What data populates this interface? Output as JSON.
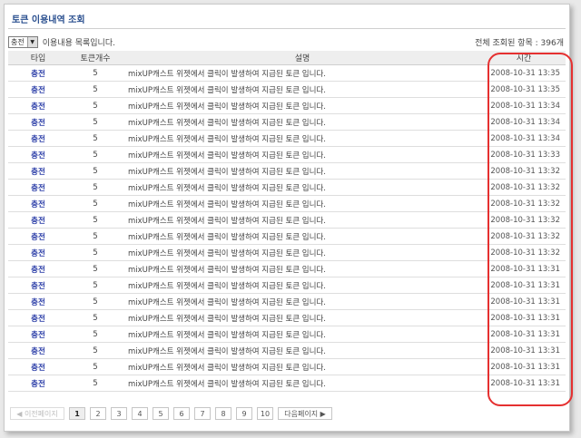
{
  "title": "토큰 이용내역 조회",
  "filter": {
    "selected": "충전",
    "label": "이용내용 목록입니다."
  },
  "total": "전체 조회된 항목 : 396개",
  "columns": [
    "타입",
    "토큰개수",
    "설명",
    "시간"
  ],
  "rows": [
    {
      "type": "충전",
      "count": "5",
      "desc": "mixUP캐스트 위젯에서 클릭이 발생하여 지급된 토큰 입니다.",
      "time": "2008-10-31 13:35"
    },
    {
      "type": "충전",
      "count": "5",
      "desc": "mixUP캐스트 위젯에서 클릭이 발생하여 지급된 토큰 입니다.",
      "time": "2008-10-31 13:35"
    },
    {
      "type": "충전",
      "count": "5",
      "desc": "mixUP캐스트 위젯에서 클릭이 발생하여 지급된 토큰 입니다.",
      "time": "2008-10-31 13:34"
    },
    {
      "type": "충전",
      "count": "5",
      "desc": "mixUP캐스트 위젯에서 클릭이 발생하여 지급된 토큰 입니다.",
      "time": "2008-10-31 13:34"
    },
    {
      "type": "충전",
      "count": "5",
      "desc": "mixUP캐스트 위젯에서 클릭이 발생하여 지급된 토큰 입니다.",
      "time": "2008-10-31 13:34"
    },
    {
      "type": "충전",
      "count": "5",
      "desc": "mixUP캐스트 위젯에서 클릭이 발생하여 지급된 토큰 입니다.",
      "time": "2008-10-31 13:33"
    },
    {
      "type": "충전",
      "count": "5",
      "desc": "mixUP캐스트 위젯에서 클릭이 발생하여 지급된 토큰 입니다.",
      "time": "2008-10-31 13:32"
    },
    {
      "type": "충전",
      "count": "5",
      "desc": "mixUP캐스트 위젯에서 클릭이 발생하여 지급된 토큰 입니다.",
      "time": "2008-10-31 13:32"
    },
    {
      "type": "충전",
      "count": "5",
      "desc": "mixUP캐스트 위젯에서 클릭이 발생하여 지급된 토큰 입니다.",
      "time": "2008-10-31 13:32"
    },
    {
      "type": "충전",
      "count": "5",
      "desc": "mixUP캐스트 위젯에서 클릭이 발생하여 지급된 토큰 입니다.",
      "time": "2008-10-31 13:32"
    },
    {
      "type": "충전",
      "count": "5",
      "desc": "mixUP캐스트 위젯에서 클릭이 발생하여 지급된 토큰 입니다.",
      "time": "2008-10-31 13:32"
    },
    {
      "type": "충전",
      "count": "5",
      "desc": "mixUP캐스트 위젯에서 클릭이 발생하여 지급된 토큰 입니다.",
      "time": "2008-10-31 13:32"
    },
    {
      "type": "충전",
      "count": "5",
      "desc": "mixUP캐스트 위젯에서 클릭이 발생하여 지급된 토큰 입니다.",
      "time": "2008-10-31 13:31"
    },
    {
      "type": "충전",
      "count": "5",
      "desc": "mixUP캐스트 위젯에서 클릭이 발생하여 지급된 토큰 입니다.",
      "time": "2008-10-31 13:31"
    },
    {
      "type": "충전",
      "count": "5",
      "desc": "mixUP캐스트 위젯에서 클릭이 발생하여 지급된 토큰 입니다.",
      "time": "2008-10-31 13:31"
    },
    {
      "type": "충전",
      "count": "5",
      "desc": "mixUP캐스트 위젯에서 클릭이 발생하여 지급된 토큰 입니다.",
      "time": "2008-10-31 13:31"
    },
    {
      "type": "충전",
      "count": "5",
      "desc": "mixUP캐스트 위젯에서 클릭이 발생하여 지급된 토큰 입니다.",
      "time": "2008-10-31 13:31"
    },
    {
      "type": "충전",
      "count": "5",
      "desc": "mixUP캐스트 위젯에서 클릭이 발생하여 지급된 토큰 입니다.",
      "time": "2008-10-31 13:31"
    },
    {
      "type": "충전",
      "count": "5",
      "desc": "mixUP캐스트 위젯에서 클릭이 발생하여 지급된 토큰 입니다.",
      "time": "2008-10-31 13:31"
    },
    {
      "type": "충전",
      "count": "5",
      "desc": "mixUP캐스트 위젯에서 클릭이 발생하여 지급된 토큰 입니다.",
      "time": "2008-10-31 13:31"
    }
  ],
  "pager": {
    "prev": "◀ 이전페이지",
    "pages": [
      "1",
      "2",
      "3",
      "4",
      "5",
      "6",
      "7",
      "8",
      "9",
      "10"
    ],
    "current": "1",
    "next": "다음페이지 ▶"
  },
  "colors": {
    "highlight": "#e53030",
    "type_link": "#2d3fa8",
    "title": "#2a4f8f"
  }
}
